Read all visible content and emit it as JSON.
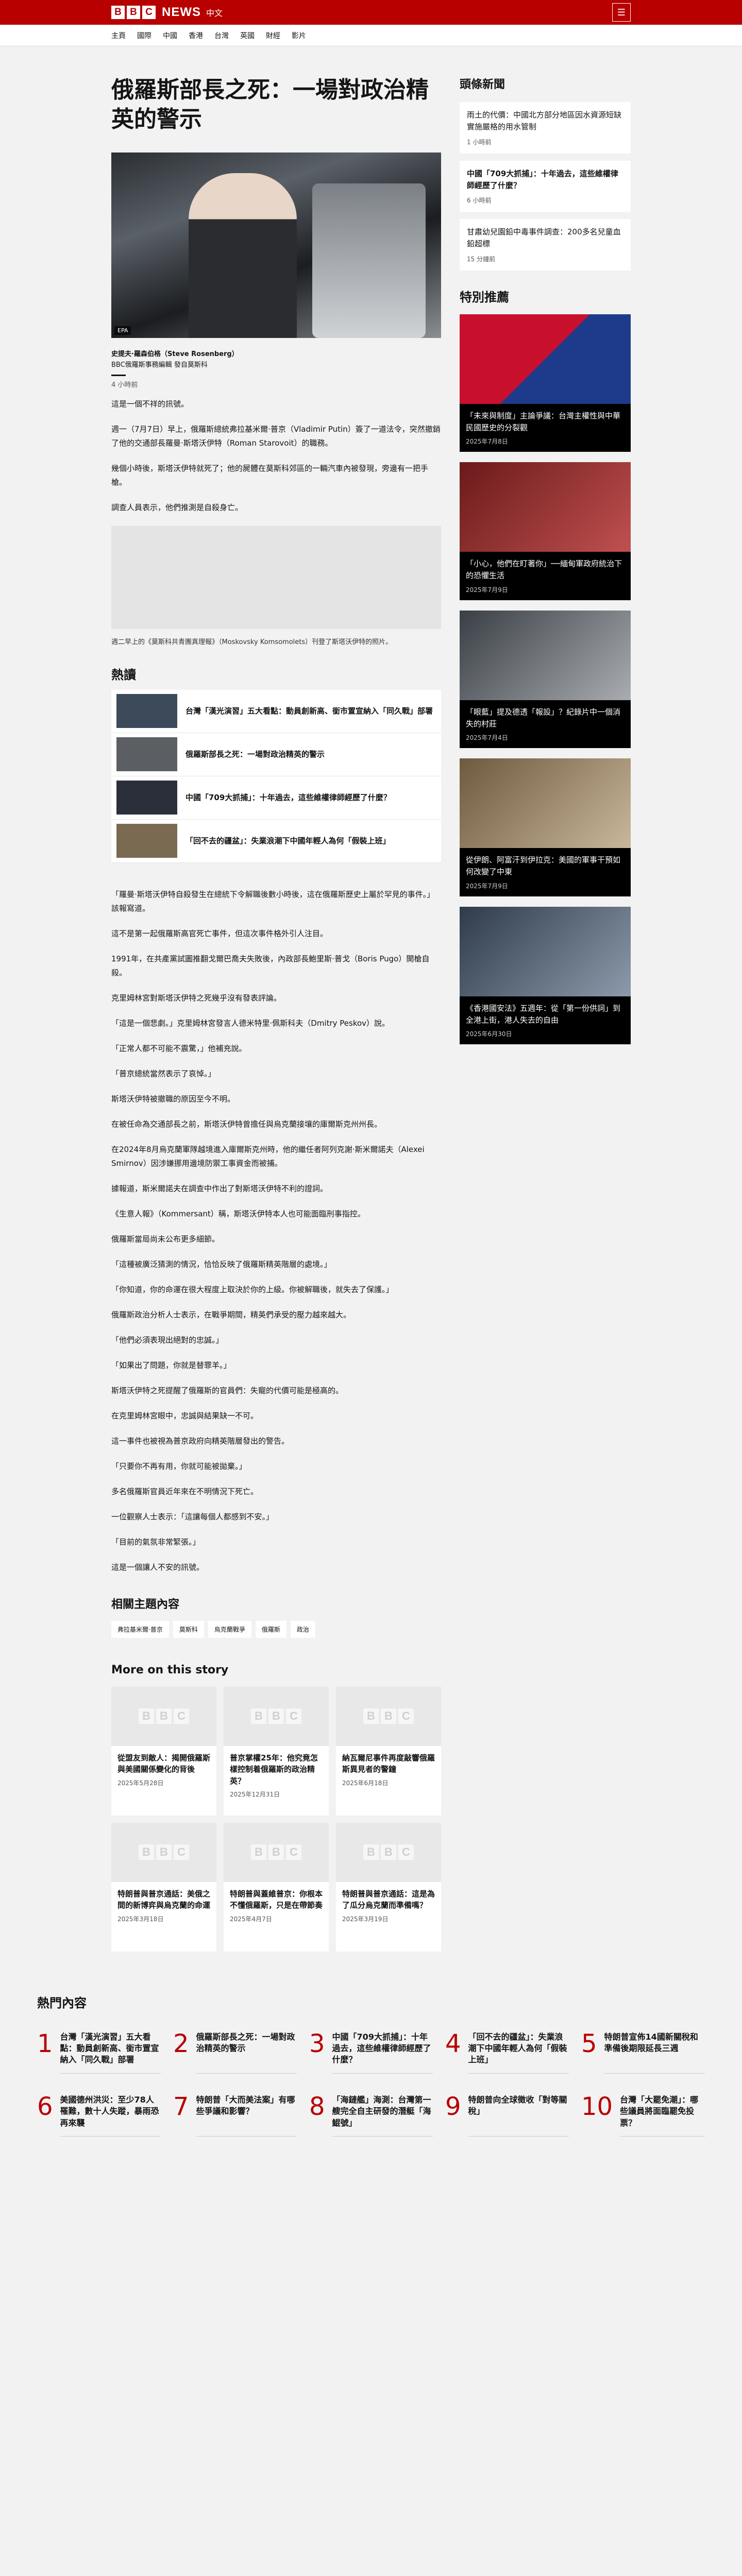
{
  "header": {
    "logo_letters": [
      "B",
      "B",
      "C"
    ],
    "logo_word": "NEWS",
    "logo_lang": "中文",
    "menu_icon": "☰"
  },
  "nav": [
    "主頁",
    "國際",
    "中國",
    "香港",
    "台灣",
    "英國",
    "財經",
    "影片"
  ],
  "article": {
    "headline": "俄羅斯部長之死：一場對政治精英的警示",
    "hero_credit": "EPA",
    "byline_name": "史提夫·羅森伯格（Steve Rosenberg）",
    "byline_role": "BBC俄羅斯事務編輯 發自莫斯科",
    "time": "4 小時前",
    "paras_top": [
      "這是一個不祥的訊號。",
      "週一（7月7日）早上，俄羅斯總統弗拉基米爾·普京（Vladimir Putin）簽了一道法令，突然撤銷了他的交通部長羅曼·斯塔沃伊特（Roman Starovoit）的職務。",
      "幾個小時後，斯塔沃伊特就死了；他的屍體在莫斯科郊區的一輛汽車內被發現，旁邊有一把手槍。",
      "調查人員表示，他們推測是自殺身亡。"
    ],
    "figcap": "週二早上的《莫斯科共青團真理報》（Moskovsky Komsomolets）刊登了斯塔沃伊特的照片。",
    "paras_bottom": [
      "「羅曼·斯塔沃伊特自殺發生在總統下令解職後數小時後，這在俄羅斯歷史上屬於罕見的事件。」該報寫道。",
      "這不是第一起俄羅斯高官死亡事件，但這次事件格外引人注目。",
      "1991年，在共產黨試圖推翻戈爾巴喬夫失敗後，內政部長鮑里斯·普戈（Boris Pugo）開槍自殺。",
      "克里姆林宮對斯塔沃伊特之死幾乎沒有發表評論。",
      "「這是一個悲劇。」克里姆林宮發言人德米特里·佩斯科夫（Dmitry Peskov）說。",
      "「正常人都不可能不震驚，」他補充說。",
      "「普京總統當然表示了哀悼。」",
      "斯塔沃伊特被撤職的原因至今不明。",
      "在被任命為交通部長之前，斯塔沃伊特曾擔任與烏克蘭接壤的庫爾斯克州州長。",
      "在2024年8月烏克蘭軍隊越境進入庫爾斯克州時，他的繼任者阿列克謝·斯米爾諾夫（Alexei Smirnov）因涉嫌挪用邊境防禦工事資金而被捕。",
      "據報道，斯米爾諾夫在調查中作出了對斯塔沃伊特不利的證詞。",
      "《生意人報》（Kommersant）稱，斯塔沃伊特本人也可能面臨刑事指控。",
      "俄羅斯當局尚未公布更多細節。",
      "「這種被廣泛猜測的情況，恰恰反映了俄羅斯精英階層的處境。」",
      "「你知道，你的命運在很大程度上取決於你的上級。你被解職後，就失去了保護。」",
      "俄羅斯政治分析人士表示，在戰爭期間，精英們承受的壓力越來越大。",
      "「他們必須表現出絕對的忠誠。」",
      "「如果出了問題，你就是替罪羊。」",
      "斯塔沃伊特之死提醒了俄羅斯的官員們：失寵的代價可能是極高的。",
      "在克里姆林宮眼中，忠誠與結果缺一不可。",
      "這一事件也被視為普京政府向精英階層發出的警告。",
      "「只要你不再有用，你就可能被拋棄。」",
      "多名俄羅斯官員近年來在不明情況下死亡。",
      "一位觀察人士表示：「這讓每個人都感到不安。」",
      "「目前的氣氛非常緊張。」",
      "這是一個讓人不安的訊號。"
    ]
  },
  "hot": {
    "title": "熱讀",
    "items": [
      "台灣「漢光演習」五大看點：動員創新高、銜市置宣納入「同久戰」部署",
      "俄羅斯部長之死：一場對政治精英的警示",
      "中國「709大抓捕」：十年過去，這些維權律師經歷了什麼？",
      "「回不去的疆盆」：失業浪潮下中國年輕人為何「假裝上班」"
    ]
  },
  "related": {
    "title": "相關主題內容",
    "tags": [
      "弗拉基米爾·普京",
      "莫斯科",
      "烏克蘭戰爭",
      "俄羅斯",
      "政治"
    ]
  },
  "more": {
    "title": "More on this story",
    "cards": [
      {
        "title": "從盟友到敵人：揭開俄羅斯與美國關係變化的背後",
        "date": "2025年5月28日"
      },
      {
        "title": "普京掌權25年：他究竟怎樣控制着俄羅斯的政治精英？",
        "date": "2025年12月31日"
      },
      {
        "title": "納瓦爾尼事件再度敲響俄羅斯異見者的警鐘",
        "date": "2025年6月18日"
      },
      {
        "title": "特朗普與普京通話：美俄之間的新博弈與烏克蘭的命運",
        "date": "2025年3月18日"
      },
      {
        "title": "特朗普與蓋維普京：你根本不懂俄羅斯，只是在帶節奏",
        "date": "2025年4月7日"
      },
      {
        "title": "特朗普與普京通話：這是為了瓜分烏克蘭而準備嗎？",
        "date": "2025年3月19日"
      }
    ]
  },
  "latest": {
    "title": "頭條新聞",
    "items": [
      {
        "text": "雨土的代價：中國北方部分地區因水資源短缺實施嚴格的用水管制",
        "time": "1 小時前",
        "bold": false
      },
      {
        "text": "中國「709大抓捕」：十年過去，這些維權律師經歷了什麼？",
        "time": "6 小時前",
        "bold": true
      },
      {
        "text": "甘肅幼兒園鉛中毒事件調查：200多名兒童血鉛超標",
        "time": "15 分鐘前",
        "bold": false
      }
    ]
  },
  "featured": {
    "title": "特別推薦",
    "items": [
      {
        "text": "「未來與制度」主論爭議：台灣主權性與中華民國歷史的分裂觀",
        "date": "2025年7月8日"
      },
      {
        "text": "「小心，他們在盯著你」──緬甸軍政府統治下的恐懼生活",
        "date": "2025年7月9日"
      },
      {
        "text": "「眼藍」提及德透「報設」？紀錄片中一個消失的村莊",
        "date": "2025年7月4日"
      },
      {
        "text": "從伊朗、阿富汗到伊拉克：美國的軍事干預如何改變了中東",
        "date": "2025年7月9日"
      },
      {
        "text": "《香港國安法》五週年：從「第一份供詞」到全港上街，港人失去的自由",
        "date": "2025年6月30日"
      }
    ]
  },
  "most_read": {
    "title": "熱門內容",
    "items": [
      "台灣「漢光演習」五大看點：動員創新高、銜市置宣納入「同久戰」部署",
      "俄羅斯部長之死：一場對政治精英的警示",
      "中國「709大抓捕」：十年過去，這些維權律師經歷了什麼？",
      "「回不去的疆盆」：失業浪潮下中國年輕人為何「假裝上班」",
      "特朗普宣佈14國新關稅和準備後期限延長三週",
      "美國德州洪災：至少78人罹難，數十人失蹤，暴雨恐再來襲",
      "特朗普「大而美法案」有哪些爭議和影響？",
      "「海鏈艦」海測：台灣第一艘完全自主研發的潛艇「海鯤號」",
      "特朗普向全球徵收「對等關稅」",
      "台灣「大罷免潮」：哪些議員將面臨罷免投票？"
    ]
  }
}
